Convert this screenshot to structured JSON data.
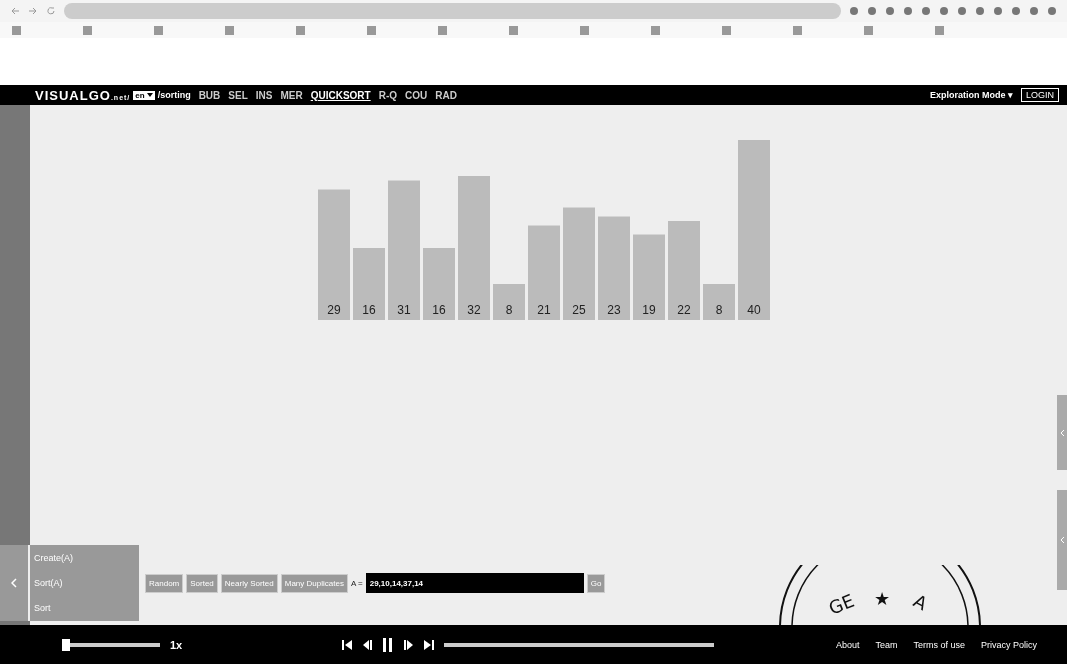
{
  "logo": {
    "text": "VISUALGO",
    "suffix": ".net/",
    "lang": "en",
    "path": "/sorting"
  },
  "nav": [
    {
      "label": "BUB",
      "selected": false
    },
    {
      "label": "SEL",
      "selected": false
    },
    {
      "label": "INS",
      "selected": false
    },
    {
      "label": "MER",
      "selected": false
    },
    {
      "label": "QUICKSORT",
      "selected": true
    },
    {
      "label": "R-Q",
      "selected": false
    },
    {
      "label": "COU",
      "selected": false
    },
    {
      "label": "RAD",
      "selected": false
    }
  ],
  "mode": "Exploration Mode ▾",
  "login": "LOGIN",
  "array": [
    "29",
    "16",
    "31",
    "16",
    "32",
    "8",
    "21",
    "25",
    "23",
    "19",
    "22",
    "8",
    "40"
  ],
  "menu": [
    "Create(A)",
    "Sort(A)",
    "Sort"
  ],
  "create_buttons": [
    "Random",
    "Sorted",
    "Nearly Sorted",
    "Many Duplicates"
  ],
  "array_input": {
    "label": "A =",
    "value": "29,10,14,37,14"
  },
  "go": "Go",
  "stamp": [
    "GE",
    "★",
    "A"
  ],
  "footer": {
    "speed": "1x",
    "links": [
      "About",
      "Team",
      "Terms of use",
      "Privacy Policy"
    ]
  }
}
